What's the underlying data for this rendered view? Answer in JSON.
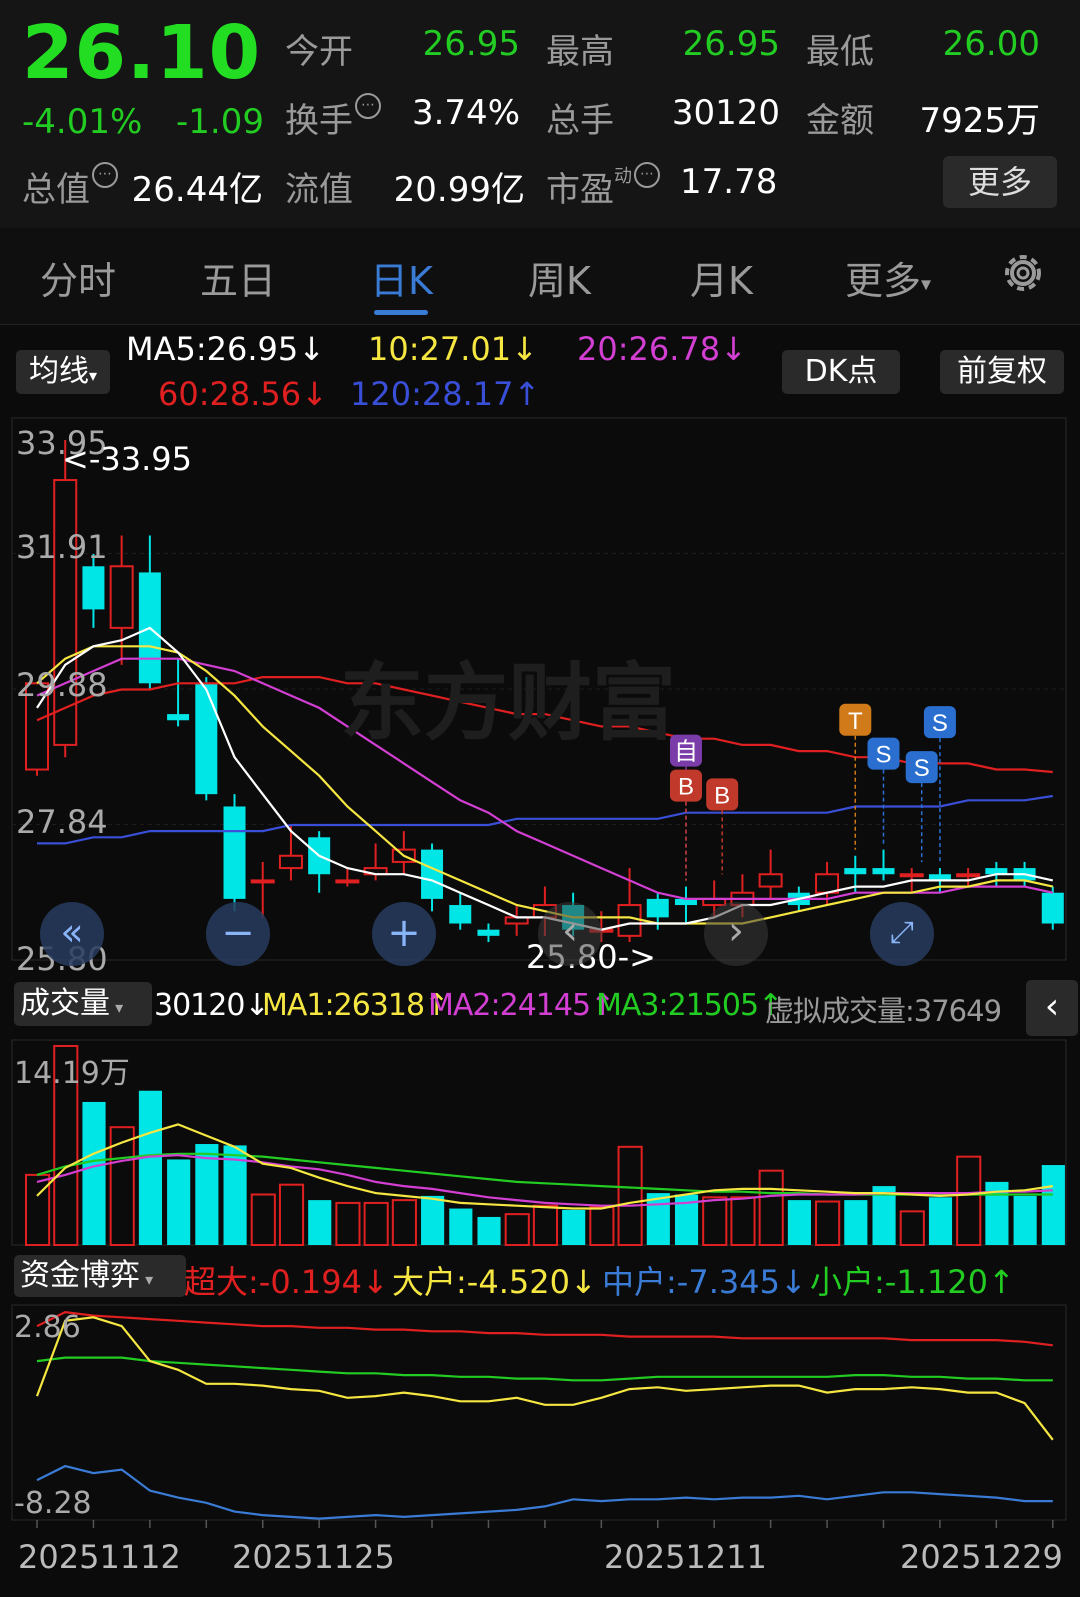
{
  "quote": {
    "price": "26.10",
    "change_pct": "-4.01%",
    "change": "-1.09",
    "open_label": "今开",
    "open": "26.95",
    "high_label": "最高",
    "high": "26.95",
    "low_label": "最低",
    "low": "26.00",
    "turnover_label": "换手",
    "turnover": "3.74%",
    "volume_label": "总手",
    "volume": "30120",
    "amount_label": "金额",
    "amount": "7925万",
    "total_value_label": "总值",
    "total_value": "26.44亿",
    "float_value_label": "流值",
    "float_value": "20.99亿",
    "pe_label": "市盈",
    "pe_sup": "动",
    "pe": "17.78",
    "more_button": "更多",
    "info_glyph": "⋯"
  },
  "tabs": [
    "分时",
    "五日",
    "日K",
    "周K",
    "月K",
    "更多"
  ],
  "active_tab": "日K",
  "settings_icon": "gear-icon",
  "kline": {
    "ma_selector": "均线",
    "dk_button": "DK点",
    "adjust_button": "前复权",
    "ma5": "MA5:26.95↓",
    "ma10": "10:27.01↓",
    "ma20": "20:26.78↓",
    "ma60": "60:28.56↓",
    "ma120": "120:28.17↑",
    "axis": [
      "33.95",
      "31.91",
      "29.88",
      "27.84",
      "25.80"
    ],
    "high_marker": "<-33.95",
    "low_marker": "25.80->",
    "watermark": "东方财富",
    "signals": [
      "自",
      "B",
      "B",
      "T",
      "S",
      "S",
      "S"
    ],
    "colors": {
      "ma5": "#ffffff",
      "ma10": "#f5e642",
      "ma20": "#d23fd2",
      "ma60": "#e02020",
      "ma120": "#3a4fd8",
      "up": "#e02020",
      "down": "#00e5e5"
    }
  },
  "volume": {
    "selector": "成交量",
    "current": "30120↓",
    "ma1": "MA1:26318↑",
    "ma2": "MA2:24145↑",
    "ma3": "MA3:21505↑",
    "virtual": "虚拟成交量:37649",
    "axis_top": "14.19万"
  },
  "capital": {
    "selector": "资金博弈",
    "super": "超大:-0.194↓",
    "large": "大户:-4.520↓",
    "medium": "中户:-7.345↓",
    "small": "小户:-1.120↑",
    "axis_top": "2.86",
    "axis_bottom": "-8.28"
  },
  "dates": [
    "20251112",
    "20251125",
    "20251211",
    "20251229"
  ],
  "chart_data": {
    "type": "candlestick",
    "ylim": [
      25.8,
      33.95
    ],
    "candles": [
      {
        "o": 28.6,
        "c": 30.0,
        "h": 30.0,
        "l": 28.5
      },
      {
        "o": 29.0,
        "c": 33.3,
        "h": 33.95,
        "l": 28.8
      },
      {
        "o": 31.9,
        "c": 31.2,
        "h": 32.1,
        "l": 30.9
      },
      {
        "o": 30.9,
        "c": 31.9,
        "h": 32.4,
        "l": 30.3
      },
      {
        "o": 31.8,
        "c": 30.0,
        "h": 32.4,
        "l": 29.9
      },
      {
        "o": 29.5,
        "c": 29.4,
        "h": 30.4,
        "l": 29.3
      },
      {
        "o": 30.0,
        "c": 28.2,
        "h": 30.1,
        "l": 28.1
      },
      {
        "o": 28.0,
        "c": 26.5,
        "h": 28.2,
        "l": 26.3
      },
      {
        "o": 26.8,
        "c": 26.8,
        "h": 27.1,
        "l": 26.2
      },
      {
        "o": 27.0,
        "c": 27.2,
        "h": 27.7,
        "l": 26.8
      },
      {
        "o": 27.5,
        "c": 26.9,
        "h": 27.6,
        "l": 26.6
      },
      {
        "o": 26.8,
        "c": 26.8,
        "h": 27.0,
        "l": 26.7
      },
      {
        "o": 26.9,
        "c": 27.0,
        "h": 27.4,
        "l": 26.8
      },
      {
        "o": 27.1,
        "c": 27.3,
        "h": 27.6,
        "l": 26.9
      },
      {
        "o": 27.3,
        "c": 26.5,
        "h": 27.4,
        "l": 26.3
      },
      {
        "o": 26.4,
        "c": 26.1,
        "h": 26.6,
        "l": 26.0
      },
      {
        "o": 26.0,
        "c": 25.9,
        "h": 26.1,
        "l": 25.8
      },
      {
        "o": 26.1,
        "c": 26.2,
        "h": 26.4,
        "l": 25.9
      },
      {
        "o": 26.2,
        "c": 26.4,
        "h": 26.7,
        "l": 25.9
      },
      {
        "o": 26.4,
        "c": 26.0,
        "h": 26.6,
        "l": 25.9
      },
      {
        "o": 26.0,
        "c": 26.0,
        "h": 26.3,
        "l": 25.8
      },
      {
        "o": 25.9,
        "c": 26.4,
        "h": 27.0,
        "l": 25.8
      },
      {
        "o": 26.5,
        "c": 26.2,
        "h": 26.6,
        "l": 26.0
      },
      {
        "o": 26.5,
        "c": 26.4,
        "h": 26.7,
        "l": 26.1
      },
      {
        "o": 26.4,
        "c": 26.5,
        "h": 26.8,
        "l": 26.2
      },
      {
        "o": 26.4,
        "c": 26.6,
        "h": 26.9,
        "l": 26.2
      },
      {
        "o": 26.7,
        "c": 26.9,
        "h": 27.3,
        "l": 26.5
      },
      {
        "o": 26.6,
        "c": 26.4,
        "h": 26.7,
        "l": 26.3
      },
      {
        "o": 26.6,
        "c": 26.9,
        "h": 27.1,
        "l": 26.4
      },
      {
        "o": 27.0,
        "c": 26.9,
        "h": 27.2,
        "l": 26.6
      },
      {
        "o": 27.0,
        "c": 26.9,
        "h": 27.3,
        "l": 26.8
      },
      {
        "o": 26.9,
        "c": 26.9,
        "h": 27.0,
        "l": 26.6
      },
      {
        "o": 26.9,
        "c": 26.8,
        "h": 27.0,
        "l": 26.6
      },
      {
        "o": 26.9,
        "c": 26.9,
        "h": 27.0,
        "l": 26.7
      },
      {
        "o": 27.0,
        "c": 26.9,
        "h": 27.1,
        "l": 26.7
      },
      {
        "o": 27.0,
        "c": 26.8,
        "h": 27.1,
        "l": 26.7
      },
      {
        "o": 26.6,
        "c": 26.1,
        "h": 26.7,
        "l": 26.0
      }
    ],
    "ma5": [
      29.6,
      30.3,
      30.6,
      30.7,
      30.9,
      30.5,
      29.9,
      28.8,
      28.2,
      27.6,
      27.2,
      27.0,
      26.9,
      26.9,
      26.8,
      26.6,
      26.4,
      26.2,
      26.2,
      26.1,
      26.0,
      26.1,
      26.1,
      26.1,
      26.2,
      26.4,
      26.4,
      26.5,
      26.6,
      26.7,
      26.7,
      26.8,
      26.8,
      26.8,
      26.9,
      26.9,
      26.8
    ],
    "ma10": [
      30.0,
      30.4,
      30.6,
      30.6,
      30.6,
      30.5,
      30.2,
      29.8,
      29.3,
      28.9,
      28.5,
      28.0,
      27.6,
      27.2,
      27.0,
      26.8,
      26.6,
      26.4,
      26.3,
      26.2,
      26.2,
      26.2,
      26.1,
      26.1,
      26.1,
      26.1,
      26.2,
      26.3,
      26.4,
      26.5,
      26.6,
      26.6,
      26.7,
      26.7,
      26.8,
      26.8,
      26.7
    ],
    "ma20": [
      29.8,
      30.0,
      30.2,
      30.4,
      30.4,
      30.4,
      30.3,
      30.2,
      30.0,
      29.8,
      29.6,
      29.3,
      29.0,
      28.7,
      28.4,
      28.1,
      27.9,
      27.6,
      27.4,
      27.2,
      27.0,
      26.8,
      26.6,
      26.5,
      26.5,
      26.5,
      26.5,
      26.5,
      26.5,
      26.6,
      26.6,
      26.6,
      26.6,
      26.7,
      26.7,
      26.7,
      26.6
    ],
    "ma60": [
      29.4,
      29.6,
      29.8,
      29.9,
      29.9,
      30.0,
      30.0,
      30.0,
      30.1,
      30.1,
      30.1,
      30.0,
      30.0,
      29.9,
      29.8,
      29.7,
      29.6,
      29.5,
      29.5,
      29.4,
      29.3,
      29.3,
      29.2,
      29.1,
      29.1,
      29.0,
      29.0,
      28.9,
      28.9,
      28.8,
      28.8,
      28.7,
      28.7,
      28.7,
      28.6,
      28.6,
      28.56
    ],
    "ma120": [
      27.4,
      27.4,
      27.5,
      27.5,
      27.6,
      27.6,
      27.6,
      27.6,
      27.6,
      27.7,
      27.7,
      27.7,
      27.7,
      27.7,
      27.7,
      27.7,
      27.7,
      27.8,
      27.8,
      27.8,
      27.8,
      27.8,
      27.8,
      27.9,
      27.9,
      27.9,
      27.9,
      27.9,
      27.9,
      28.0,
      28.0,
      28.0,
      28.0,
      28.1,
      28.1,
      28.1,
      28.17
    ],
    "volume": [
      5.0,
      14.19,
      10.2,
      8.4,
      11.0,
      6.1,
      7.2,
      7.1,
      3.6,
      4.3,
      3.2,
      3.0,
      3.0,
      3.2,
      3.5,
      2.6,
      2.0,
      2.2,
      2.8,
      2.5,
      2.7,
      7.0,
      3.7,
      3.6,
      3.4,
      3.4,
      5.3,
      3.2,
      3.1,
      3.2,
      4.2,
      2.4,
      3.4,
      6.3,
      4.5,
      3.5,
      5.7
    ],
    "vol_ma1": [
      3.5,
      5.5,
      6.5,
      7.3,
      8.0,
      8.6,
      7.8,
      7.0,
      5.8,
      5.5,
      4.8,
      4.2,
      3.7,
      3.5,
      3.3,
      3.0,
      2.9,
      2.8,
      2.7,
      2.6,
      2.6,
      3.0,
      3.3,
      3.6,
      3.9,
      4.0,
      4.0,
      3.9,
      3.8,
      3.7,
      3.7,
      3.6,
      3.5,
      3.6,
      3.8,
      3.9,
      4.2
    ],
    "vol_ma2": [
      4.5,
      5.0,
      5.6,
      6.0,
      6.3,
      6.4,
      6.2,
      6.1,
      5.9,
      5.6,
      5.4,
      5.0,
      4.5,
      4.2,
      4.0,
      3.7,
      3.4,
      3.2,
      3.0,
      2.9,
      2.8,
      2.8,
      2.9,
      3.0,
      3.2,
      3.3,
      3.5,
      3.6,
      3.6,
      3.6,
      3.7,
      3.7,
      3.7,
      3.7,
      3.8,
      3.8,
      3.9
    ],
    "vol_ma3": [
      5.0,
      5.6,
      6.0,
      6.2,
      6.4,
      6.5,
      6.5,
      6.4,
      6.3,
      6.1,
      5.9,
      5.7,
      5.5,
      5.3,
      5.1,
      4.9,
      4.7,
      4.5,
      4.4,
      4.3,
      4.2,
      4.1,
      4.0,
      3.9,
      3.8,
      3.8,
      3.7,
      3.7,
      3.6,
      3.6,
      3.6,
      3.6,
      3.6,
      3.6,
      3.6,
      3.6,
      3.6
    ],
    "cap_super": [
      2.0,
      2.8,
      2.6,
      2.5,
      2.4,
      2.3,
      2.2,
      2.1,
      2.0,
      2.0,
      1.9,
      1.9,
      1.8,
      1.8,
      1.7,
      1.7,
      1.6,
      1.6,
      1.5,
      1.5,
      1.5,
      1.4,
      1.4,
      1.4,
      1.4,
      1.3,
      1.3,
      1.3,
      1.3,
      1.3,
      1.3,
      1.2,
      1.2,
      1.2,
      1.2,
      1.1,
      0.9
    ],
    "cap_large": [
      -2.0,
      2.3,
      2.5,
      2.0,
      0.0,
      -0.5,
      -1.3,
      -1.3,
      -1.4,
      -1.6,
      -1.7,
      -2.1,
      -2.0,
      -1.8,
      -2.0,
      -2.3,
      -2.3,
      -2.1,
      -2.5,
      -2.5,
      -2.1,
      -1.6,
      -1.5,
      -1.7,
      -1.6,
      -1.5,
      -1.4,
      -1.4,
      -1.8,
      -1.6,
      -1.6,
      -1.5,
      -1.6,
      -1.8,
      -1.8,
      -2.4,
      -4.5
    ],
    "cap_medium": [
      -6.8,
      -6.0,
      -6.4,
      -6.2,
      -7.4,
      -7.8,
      -8.1,
      -8.6,
      -8.8,
      -8.9,
      -9.0,
      -8.9,
      -8.8,
      -8.9,
      -8.8,
      -8.7,
      -8.6,
      -8.5,
      -8.3,
      -7.9,
      -8.0,
      -7.9,
      -7.9,
      -7.8,
      -7.9,
      -7.8,
      -7.8,
      -7.7,
      -7.9,
      -7.7,
      -7.5,
      -7.5,
      -7.6,
      -7.7,
      -7.8,
      -8.0,
      -8.0
    ],
    "cap_small": [
      0.0,
      0.2,
      0.2,
      0.2,
      0.0,
      -0.1,
      -0.2,
      -0.3,
      -0.4,
      -0.5,
      -0.6,
      -0.7,
      -0.7,
      -0.8,
      -0.8,
      -0.9,
      -0.9,
      -1.0,
      -1.0,
      -1.1,
      -1.1,
      -1.0,
      -0.9,
      -0.9,
      -0.9,
      -0.9,
      -0.9,
      -0.9,
      -0.9,
      -0.8,
      -0.8,
      -0.9,
      -0.9,
      -1.0,
      -1.0,
      -1.1,
      -1.1
    ]
  }
}
